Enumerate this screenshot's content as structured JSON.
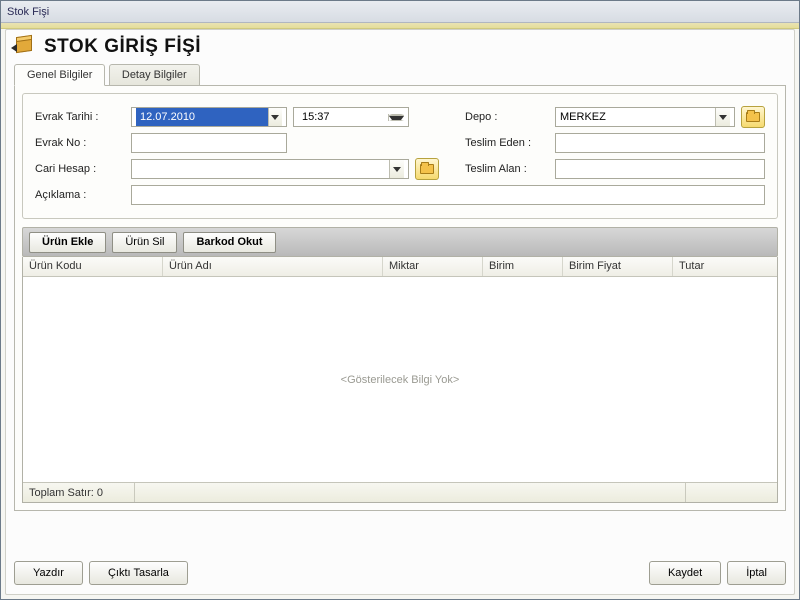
{
  "window": {
    "title": "Stok Fişi"
  },
  "header": {
    "title": "STOK GİRİŞ FİŞİ"
  },
  "tabs": {
    "general": "Genel Bilgiler",
    "detail": "Detay Bilgiler"
  },
  "form": {
    "labels": {
      "evrak_tarihi": "Evrak Tarihi :",
      "evrak_no": "Evrak No :",
      "cari_hesap": "Cari Hesap :",
      "aciklama": "Açıklama :",
      "depo": "Depo :",
      "teslim_eden": "Teslim Eden :",
      "teslim_alan": "Teslim Alan :"
    },
    "values": {
      "evrak_tarihi": "12.07.2010",
      "evrak_saat": "15:37",
      "evrak_no": "",
      "cari_hesap": "",
      "aciklama": "",
      "depo": "MERKEZ",
      "teslim_eden": "",
      "teslim_alan": ""
    }
  },
  "toolbar": {
    "add": "Ürün Ekle",
    "del": "Ürün Sil",
    "barcode": "Barkod Okut"
  },
  "grid": {
    "headers": {
      "urun_kodu": "Ürün Kodu",
      "urun_adi": "Ürün Adı",
      "miktar": "Miktar",
      "birim": "Birim",
      "birim_fiyat": "Birim Fiyat",
      "tutar": "Tutar"
    },
    "empty_text": "<Gösterilecek Bilgi Yok>",
    "footer": "Toplam Satır: 0"
  },
  "buttons": {
    "print": "Yazdır",
    "design": "Çıktı Tasarla",
    "save": "Kaydet",
    "cancel": "İptal"
  }
}
